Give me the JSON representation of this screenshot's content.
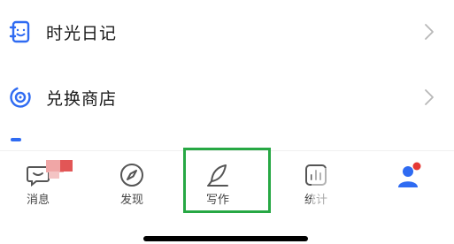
{
  "menu": {
    "items": [
      {
        "label": "时光日记",
        "icon": "diary-icon"
      },
      {
        "label": "兑换商店",
        "icon": "exchange-store-icon"
      }
    ]
  },
  "tabbar": {
    "tabs": [
      {
        "label": "消息",
        "icon": "message-icon"
      },
      {
        "label": "发现",
        "icon": "compass-icon"
      },
      {
        "label": "写作",
        "icon": "feather-pen-icon"
      },
      {
        "label": "统计",
        "icon": "bar-chart-icon"
      },
      {
        "label": "",
        "icon": "user-icon"
      }
    ]
  },
  "colors": {
    "accent": "#2f6bf2",
    "highlight": "#27a844",
    "badge": "#e53935"
  }
}
